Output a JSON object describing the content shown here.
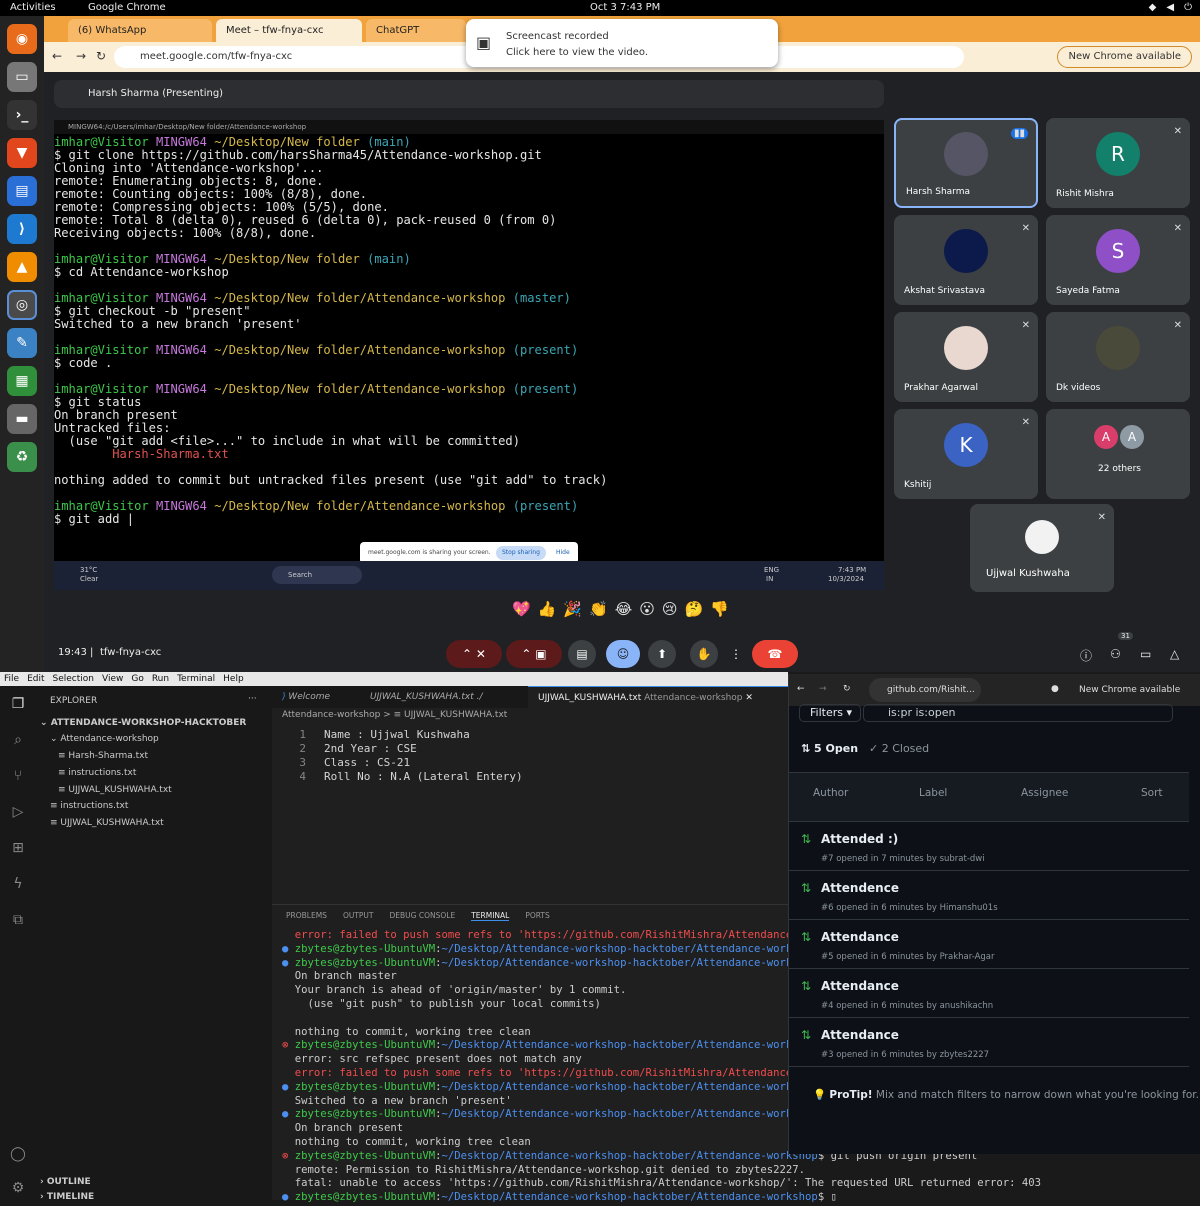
{
  "topbar": {
    "activities": "Activities",
    "app": "Google Chrome",
    "clock": "Oct 3  7:43 PM"
  },
  "chrome": {
    "tabs": [
      {
        "label": "(6) WhatsApp"
      },
      {
        "label": "Meet – tfw-fnya-cxc"
      },
      {
        "label": "ChatGPT"
      }
    ],
    "url": "meet.google.com/tfw-fnya-cxc",
    "new_chrome": "New Chrome available",
    "toast_title": "Screencast recorded",
    "toast_sub": "Click here to view the video."
  },
  "meet": {
    "presenting": "Harsh Sharma (Presenting)",
    "term_title": "MINGW64:/c/Users/imhar/Desktop/New folder/Attendance-workshop",
    "share_text": "meet.google.com is sharing your screen.",
    "stop_sharing": "Stop sharing",
    "hide": "Hide",
    "taskbar": {
      "weather": "31°C",
      "weather2": "Clear",
      "search": "Search",
      "lang": "ENG",
      "lang2": "IN",
      "time": "7:43 PM",
      "date": "10/3/2024"
    },
    "participants": [
      {
        "name": "Harsh Sharma",
        "initial": ""
      },
      {
        "name": "Rishit Mishra",
        "initial": "R"
      },
      {
        "name": "Akshat Srivastava",
        "initial": ""
      },
      {
        "name": "Sayeda Fatma",
        "initial": "S"
      },
      {
        "name": "Prakhar Agarwal",
        "initial": ""
      },
      {
        "name": "Dk videos",
        "initial": ""
      },
      {
        "name": "Kshitij",
        "initial": "K"
      },
      {
        "name": "22 others",
        "initial": "A"
      },
      {
        "name": "Ujjwal Kushwaha",
        "initial": ""
      }
    ],
    "others_initial2": "A",
    "meeting_time": "19:43",
    "meeting_code": "tfw-fnya-cxc",
    "people_count": "31",
    "reactions": [
      "💖",
      "👍",
      "🎉",
      "👏",
      "😂",
      "😮",
      "😢",
      "🤔",
      "👎"
    ]
  },
  "vscode": {
    "menu": [
      "File",
      "Edit",
      "Selection",
      "View",
      "Go",
      "Run",
      "Terminal",
      "Help"
    ],
    "explorer_title": "EXPLORER",
    "root": "ATTENDANCE-WORKSHOP-HACKTOBER",
    "tree": [
      "Attendance-workshop",
      "Harsh-Sharma.txt",
      "instructions.txt",
      "UJJWAL_KUSHWAHA.txt",
      "instructions.txt",
      "UJJWAL_KUSHWAHA.txt"
    ],
    "outline": "OUTLINE",
    "timeline": "TIMELINE",
    "tabs": [
      "Welcome",
      "UJJWAL_KUSHWAHA.txt ./",
      "UJJWAL_KUSHWAHA.txt"
    ],
    "active_tab_path": "Attendance-workshop",
    "breadcrumb": "Attendance-workshop  >  ≡ UJJWAL_KUSHWAHA.txt",
    "code": [
      "Name : Ujjwal Kushwaha",
      "2nd Year : CSE",
      "Class : CS-21",
      "Roll No : N.A (Lateral Entery)"
    ],
    "panel_tabs": [
      "PROBLEMS",
      "OUTPUT",
      "DEBUG CONSOLE",
      "TERMINAL",
      "PORTS"
    ]
  },
  "github": {
    "url": "github.com/Rishit...",
    "new_chrome": "New Chrome available",
    "filters": "Filters",
    "query": "is:pr is:open",
    "open_count": "5 Open",
    "closed_count": "2 Closed",
    "cols": [
      "Author",
      "Label",
      "Assignee",
      "Sort"
    ],
    "prs": [
      {
        "title": "Attended :)",
        "meta": "#7 opened in 7 minutes by subrat-dwi"
      },
      {
        "title": "Attendence",
        "meta": "#6 opened in 6 minutes by Himanshu01s"
      },
      {
        "title": "Attendance",
        "meta": "#5 opened in 6 minutes by Prakhar-Agar"
      },
      {
        "title": "Attendance",
        "meta": "#4 opened in 6 minutes by anushikachn"
      },
      {
        "title": "Attendance",
        "meta": "#3 opened in 6 minutes by zbytes2227"
      }
    ],
    "protip_label": "ProTip!",
    "protip": "Mix and match filters to narrow down what you're looking for."
  }
}
